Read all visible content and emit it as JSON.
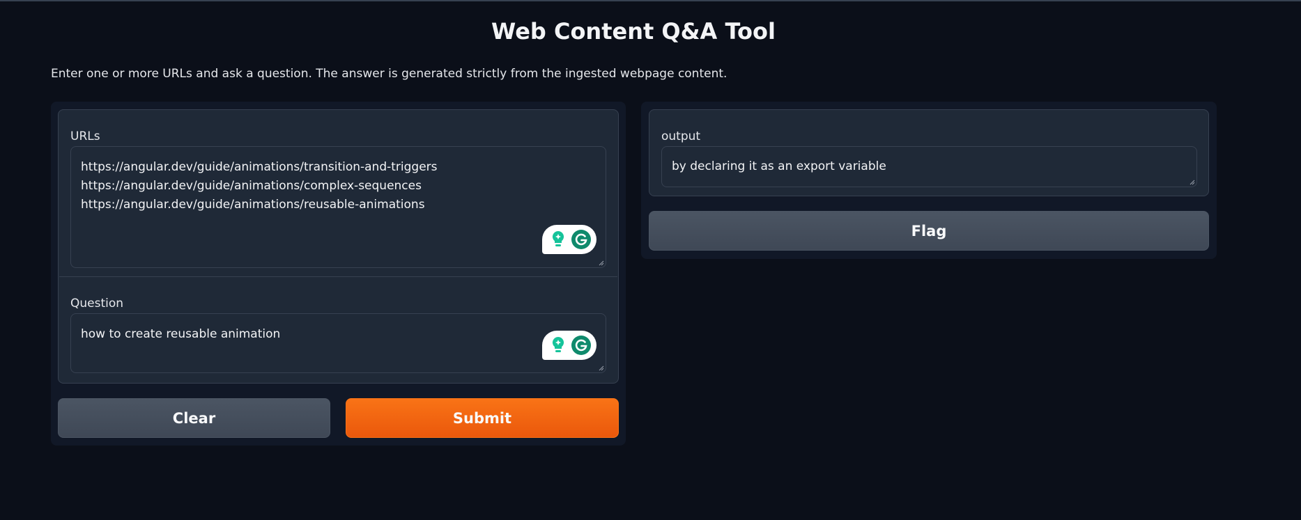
{
  "header": {
    "title": "Web Content Q&A Tool",
    "description": "Enter one or more URLs and ask a question. The answer is generated strictly from the ingested webpage content."
  },
  "inputs": {
    "urls_label": "URLs",
    "urls_lines": [
      "https://angular.dev/guide/animations/transition-and-triggers",
      "https://angular.dev/guide/animations/complex-sequences",
      "https://angular.dev/guide/animations/reusable-animations"
    ],
    "question_label": "Question",
    "question_value": "how to create reusable animation"
  },
  "actions": {
    "clear_label": "Clear",
    "submit_label": "Submit",
    "flag_label": "Flag"
  },
  "output": {
    "label": "output",
    "value": "by declaring it as an export variable"
  },
  "icons": {
    "assistant": "grammarly-assistant-icon",
    "grammarly": "grammarly-g-icon"
  },
  "colors": {
    "background": "#0b0f19",
    "panel": "#111827",
    "block": "#1f2937",
    "primary": "#f97316",
    "secondary": "#4b5563",
    "grammarly": "#15c39a"
  }
}
